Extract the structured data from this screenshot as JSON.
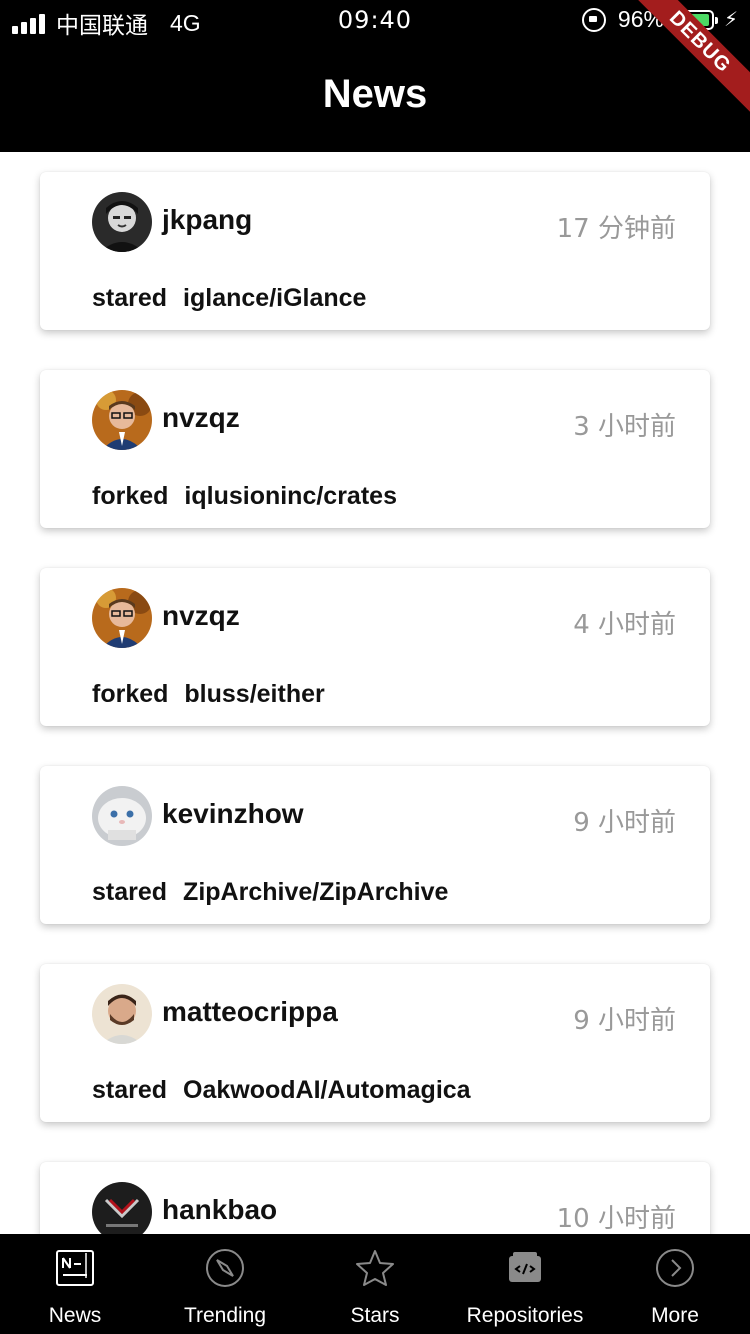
{
  "status_bar": {
    "carrier": "中国联通",
    "network": "4G",
    "time": "09:40",
    "battery_pct": "96%",
    "battery_level": 0.96
  },
  "header": {
    "title": "News"
  },
  "debug_banner": "DEBUG",
  "feed": [
    {
      "username": "jkpang",
      "time": "17 分钟前",
      "verb": "stared",
      "repo": "iglance/iGlance",
      "avatar": "avatar-bw-portrait"
    },
    {
      "username": "nvzqz",
      "time": "3 小时前",
      "verb": "forked",
      "repo": "iqlusioninc/crates",
      "avatar": "avatar-glasses-man"
    },
    {
      "username": "nvzqz",
      "time": "4 小时前",
      "verb": "forked",
      "repo": "bluss/either",
      "avatar": "avatar-glasses-man"
    },
    {
      "username": "kevinzhow",
      "time": "9 小时前",
      "verb": "stared",
      "repo": "ZipArchive/ZipArchive",
      "avatar": "avatar-white-cat"
    },
    {
      "username": "matteocrippa",
      "time": "9 小时前",
      "verb": "stared",
      "repo": "OakwoodAI/Automagica",
      "avatar": "avatar-bearded-man"
    },
    {
      "username": "hankbao",
      "time": "10 小时前",
      "verb": "",
      "repo": "",
      "avatar": "avatar-corvette-logo"
    }
  ],
  "tabs": [
    {
      "label": "News",
      "icon": "news-icon",
      "active": true
    },
    {
      "label": "Trending",
      "icon": "compass-icon",
      "active": false
    },
    {
      "label": "Stars",
      "icon": "star-icon",
      "active": false
    },
    {
      "label": "Repositories",
      "icon": "repository-icon",
      "active": false
    },
    {
      "label": "More",
      "icon": "chevron-right-circle-icon",
      "active": false
    }
  ],
  "colors": {
    "header_bg": "#000000",
    "time_gray": "#999999",
    "debug_red": "#a31d1d",
    "battery_green": "#4cd964"
  }
}
